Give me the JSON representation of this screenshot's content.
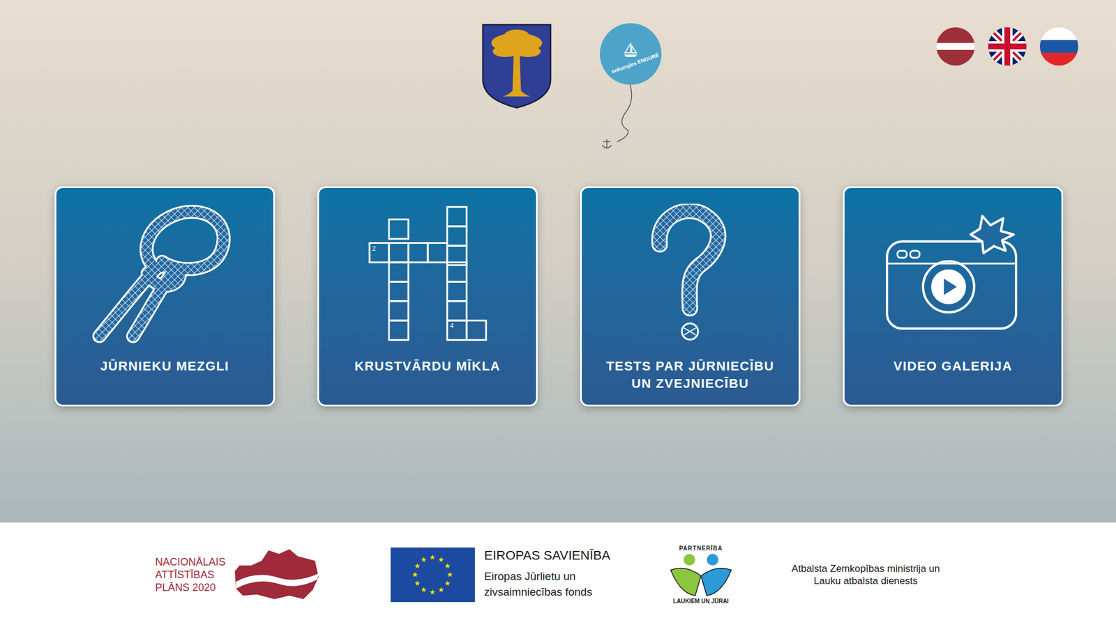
{
  "header": {
    "badge": {
      "text": "enkurojies ENGURĒ"
    }
  },
  "languages": [
    {
      "kind": "lv"
    },
    {
      "kind": "en"
    },
    {
      "kind": "ru"
    }
  ],
  "cards": [
    {
      "kind": "knot",
      "label_lines": [
        "JŪRNIEKU MEZGLI"
      ],
      "numbers": []
    },
    {
      "kind": "crossword",
      "label_lines": [
        "KRUSTVĀRDU MĪKLA"
      ],
      "numbers": [
        "2",
        "4"
      ]
    },
    {
      "kind": "quiz",
      "label_lines": [
        "TESTS PAR JŪRNIECĪBU",
        "UN ZVEJNIECĪBU"
      ],
      "numbers": []
    },
    {
      "kind": "video",
      "label_lines": [
        "VIDEO GALERIJA"
      ],
      "numbers": []
    }
  ],
  "footer": {
    "nap": {
      "lines": [
        "NACIONĀLAIS",
        "ATTĪSTĪBAS",
        "PLĀNS 2020"
      ]
    },
    "eu": {
      "title": "EIROPAS SAVIENĪBA",
      "lines": [
        "Eiropas Jūrlietu un",
        "zivsaimniecības fonds"
      ]
    },
    "partnership": {
      "top": "PARTNERĪBA",
      "bottom": "LAUKIEM UN JŪRAI"
    },
    "support": {
      "lines": [
        "Atbalsta Zemkopības ministrija un",
        "Lauku atbalsta dienests"
      ]
    }
  }
}
